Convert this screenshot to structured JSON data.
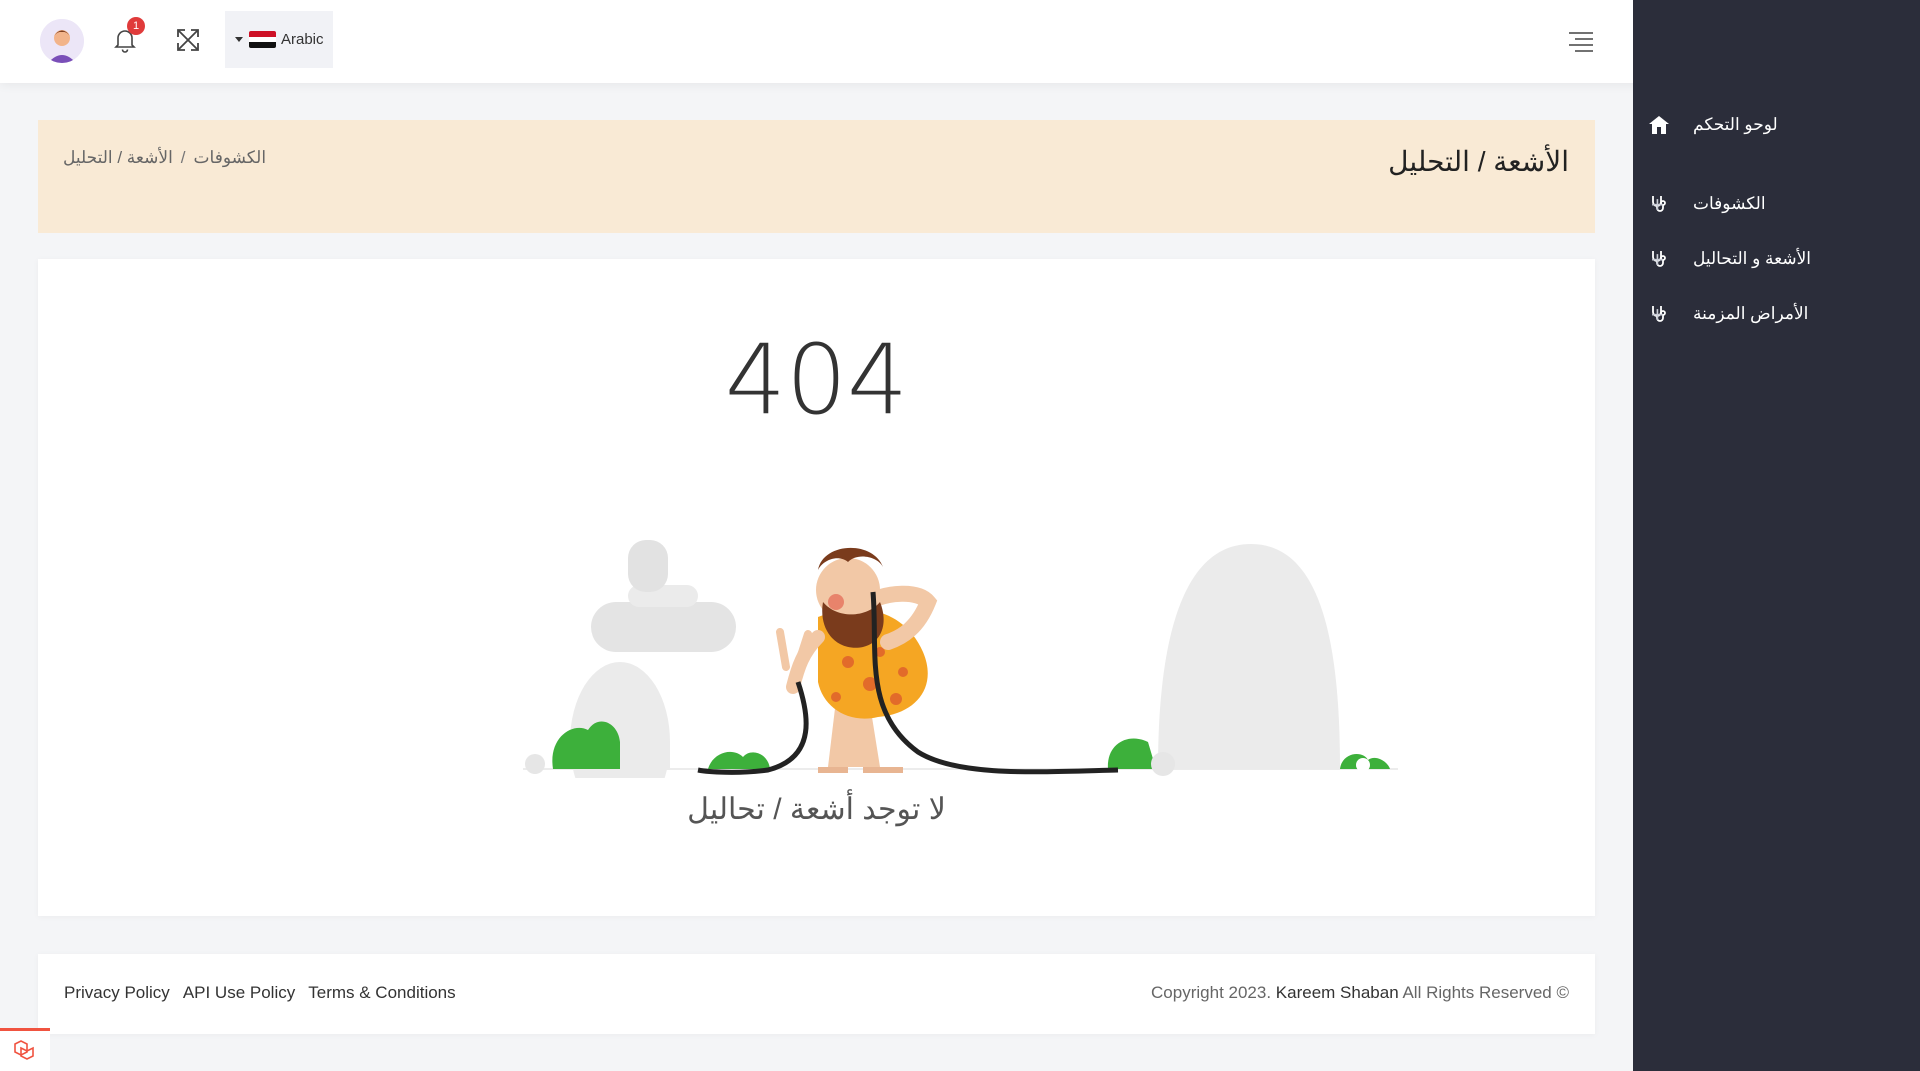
{
  "header": {
    "notification_count": "1",
    "language_label": "Arabic",
    "icons": {
      "avatar": "avatar",
      "bell": "bell-icon",
      "expand": "expand-icon",
      "menu": "menu-icon"
    }
  },
  "sidebar": {
    "items": [
      {
        "label": "لوحو التحكم",
        "icon": "home-icon",
        "expandable": false
      },
      {
        "label": "الكشوفات",
        "icon": "stethoscope-icon",
        "expandable": true
      },
      {
        "label": "الأشعة و التحاليل",
        "icon": "stethoscope-icon",
        "expandable": true
      },
      {
        "label": "الأمراض المزمنة",
        "icon": "stethoscope-icon",
        "expandable": true
      }
    ],
    "plus_symbol": "+"
  },
  "page": {
    "title": "الأشعة / التحليل",
    "breadcrumb": [
      "الكشوفات",
      "/",
      "الأشعة / التحليل"
    ]
  },
  "main": {
    "error_code": "404",
    "message": "لا توجد أشعة / تحاليل"
  },
  "footer": {
    "links": [
      "Privacy Policy",
      "API Use Policy",
      "Terms & Conditions"
    ],
    "copyright_prefix": "© Copyright 2023.",
    "copyright_author": "Kareem Shaban",
    "copyright_suffix": "All Rights Reserved"
  },
  "colors": {
    "sidebar_bg": "#2b2d3a",
    "title_bar_bg": "#f9ead5",
    "badge": "#e03b3b",
    "plant_green": "#3db03b",
    "rock_gray": "#ebebeb"
  }
}
